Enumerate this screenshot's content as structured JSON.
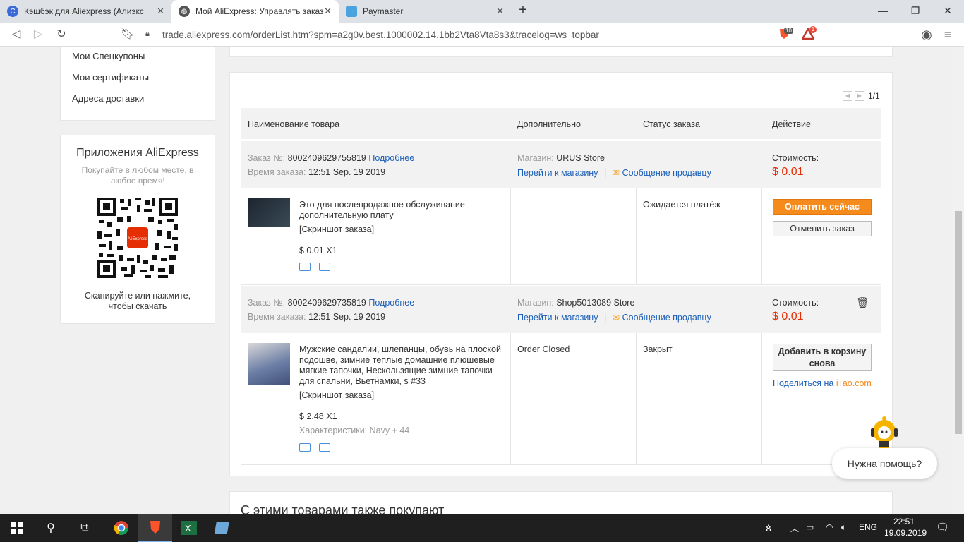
{
  "browser": {
    "tabs": [
      {
        "label": "Кэшбэк для Aliexpress (Алиэкспресс)",
        "icon": "cashback-icon",
        "color": "#3b6ad8"
      },
      {
        "label": "Мой AliExpress: Управлять заказами",
        "icon": "globe-icon",
        "color": "#555555"
      },
      {
        "label": "Paymaster",
        "icon": "paymaster-icon",
        "color": "#4aa3df"
      }
    ],
    "url": "trade.aliexpress.com/orderList.htm?spm=a2g0v.best.1000002.14.1bb2Vta8Vta8s3&tracelog=ws_topbar",
    "brave_badge": "10",
    "alert_badge": "1"
  },
  "sidebar": {
    "links": [
      "Мои Спецкупоны",
      "Мои сертификаты",
      "Адреса доставки"
    ],
    "apps": {
      "title": "Приложения AliExpress",
      "subtitle": "Покупайте в любом месте, в любое время!",
      "qr_logo": "AliExpress",
      "scan_text": "Сканируйте или нажмите, чтобы скачать"
    }
  },
  "orders": {
    "pagination": "1/1",
    "headers": {
      "product": "Наименование товара",
      "extra": "Дополнительно",
      "status": "Статус заказа",
      "action": "Действие"
    },
    "labels": {
      "order_no": "Заказ №:",
      "order_time": "Время заказа:",
      "details": "Подробнее",
      "store": "Магазин:",
      "go_store": "Перейти к магазину",
      "separator": "|",
      "message": "Сообщение продавцу",
      "cost": "Стоимость:",
      "snapshot": "[Скриншот заказа]"
    },
    "items": [
      {
        "number": "8002409629755819",
        "time": "12:51 Sep. 19 2019",
        "store": "URUS Store",
        "price": "$ 0.01",
        "product": "Это для послепродажное обслуживание дополнительную плату",
        "qty": "$ 0.01 X1",
        "extra": "",
        "status": "Ожидается платёж",
        "pay_button": "Оплатить сейчас",
        "cancel_button": "Отменить заказ"
      },
      {
        "number": "8002409629735819",
        "time": "12:51 Sep. 19 2019",
        "store": "Shop5013089 Store",
        "price": "$ 0.01",
        "product": "Мужские сандалии, шлепанцы, обувь на плоской подошве, зимние теплые домашние плюшевые мягкие тапочки, Нескользящие зимние тапочки для спальни, Вьетнамки, s #33",
        "qty": "$ 2.48 X1",
        "characteristics": "Характеристики: Navy + 44",
        "extra": "Order Closed",
        "status": "Закрыт",
        "cart_button": "Добавить в корзину снова",
        "share_prefix": "Поделиться на ",
        "share_site": "iTao.com"
      }
    ]
  },
  "recommend_title": "С этими товарами также покупают",
  "help_bubble": "Нужна помощь?",
  "taskbar": {
    "lang": "ENG",
    "time": "22:51",
    "date": "19.09.2019"
  }
}
